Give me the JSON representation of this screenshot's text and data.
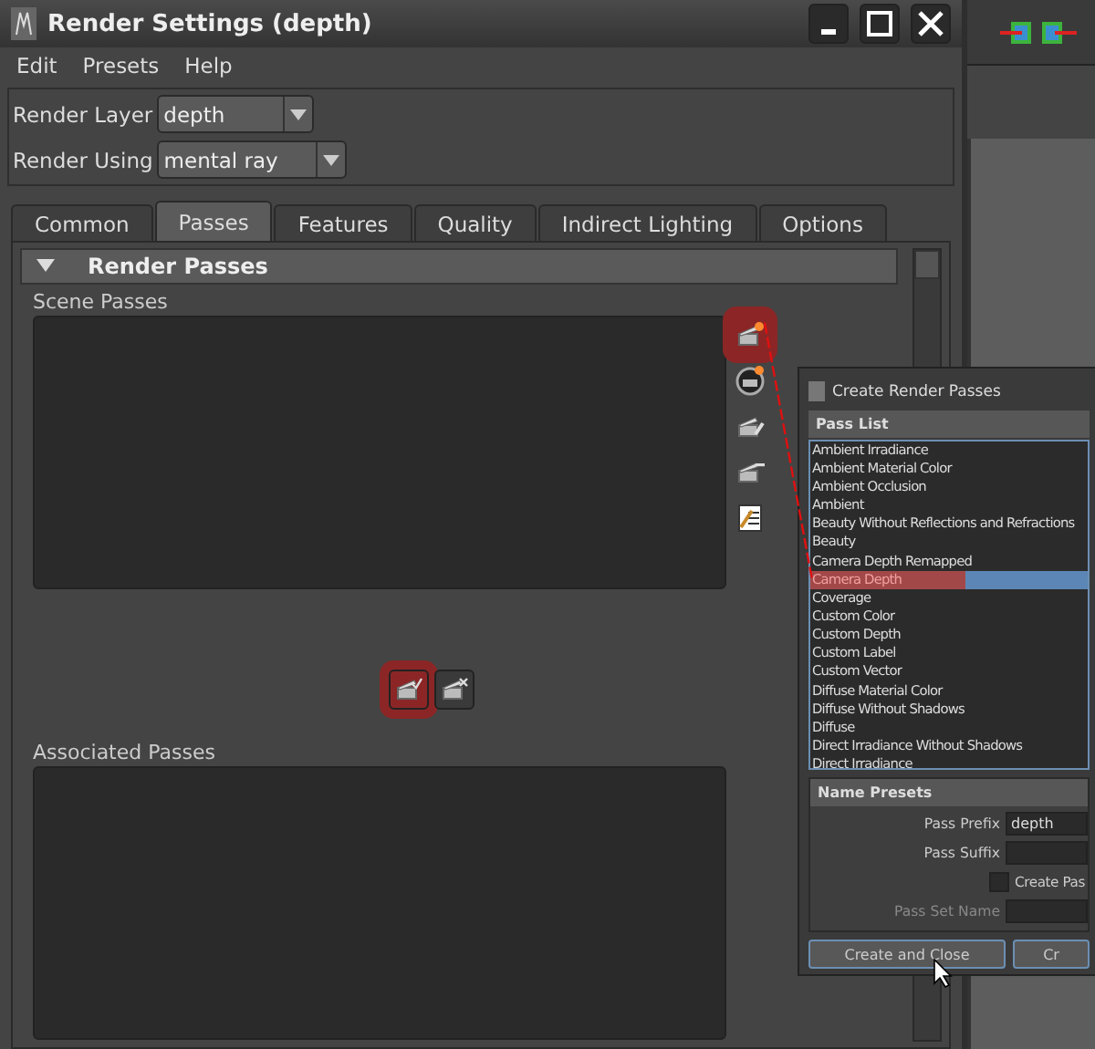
{
  "window": {
    "title": "Render Settings (depth)"
  },
  "menu": [
    "Edit",
    "Presets",
    "Help"
  ],
  "render_layer": {
    "label": "Render Layer",
    "value": "depth"
  },
  "render_using": {
    "label": "Render Using",
    "value": "mental ray"
  },
  "tabs": [
    {
      "label": "Common",
      "selected": false
    },
    {
      "label": "Passes",
      "selected": true
    },
    {
      "label": "Features",
      "selected": false
    },
    {
      "label": "Quality",
      "selected": false
    },
    {
      "label": "Indirect Lighting",
      "selected": false
    },
    {
      "label": "Options",
      "selected": false
    }
  ],
  "section": {
    "title": "Render Passes",
    "expanded": true
  },
  "scene_passes": {
    "label": "Scene Passes"
  },
  "side_tools": [
    {
      "kind": "star",
      "highlighted": true
    },
    {
      "kind": "circle",
      "highlighted": false
    },
    {
      "kind": "pencil",
      "highlighted": false
    },
    {
      "kind": "minus",
      "highlighted": false
    },
    {
      "kind": "document",
      "highlighted": false
    }
  ],
  "link_tools": [
    {
      "kind": "check",
      "highlighted": true
    },
    {
      "kind": "cross",
      "highlighted": false
    }
  ],
  "associated_passes": {
    "label": "Associated Passes"
  },
  "dialog": {
    "title": "Create Render Passes",
    "pass_list_title": "Pass List",
    "passes": [
      {
        "label": "Ambient Irradiance",
        "selected": false,
        "highlighted": false
      },
      {
        "label": "Ambient Material Color",
        "selected": false,
        "highlighted": false
      },
      {
        "label": "Ambient Occlusion",
        "selected": false,
        "highlighted": false
      },
      {
        "label": "Ambient",
        "selected": false,
        "highlighted": false
      },
      {
        "label": "Beauty Without Reflections and Refractions",
        "selected": false,
        "highlighted": false
      },
      {
        "label": "Beauty",
        "selected": false,
        "highlighted": false
      },
      {
        "label": "Camera Depth Remapped",
        "selected": false,
        "highlighted": false
      },
      {
        "label": "Camera Depth",
        "selected": true,
        "highlighted": true
      },
      {
        "label": "Coverage",
        "selected": false,
        "highlighted": false
      },
      {
        "label": "Custom Color",
        "selected": false,
        "highlighted": false
      },
      {
        "label": "Custom Depth",
        "selected": false,
        "highlighted": false
      },
      {
        "label": "Custom Label",
        "selected": false,
        "highlighted": false
      },
      {
        "label": "Custom Vector",
        "selected": false,
        "highlighted": false
      },
      {
        "label": "Diffuse Material Color",
        "selected": false,
        "highlighted": false
      },
      {
        "label": "Diffuse Without Shadows",
        "selected": false,
        "highlighted": false
      },
      {
        "label": "Diffuse",
        "selected": false,
        "highlighted": false
      },
      {
        "label": "Direct Irradiance Without Shadows",
        "selected": false,
        "highlighted": false
      },
      {
        "label": "Direct Irradiance",
        "selected": false,
        "highlighted": false
      }
    ],
    "name_presets_title": "Name Presets",
    "pass_prefix": {
      "label": "Pass Prefix",
      "value": "depth"
    },
    "pass_suffix": {
      "label": "Pass Suffix"
    },
    "create_pass_set": {
      "label": "Create Pas",
      "checked": false
    },
    "pass_set_name": {
      "label": "Pass Set Name",
      "disabled": true
    },
    "buttons": [
      "Create and Close",
      "Cr"
    ]
  }
}
